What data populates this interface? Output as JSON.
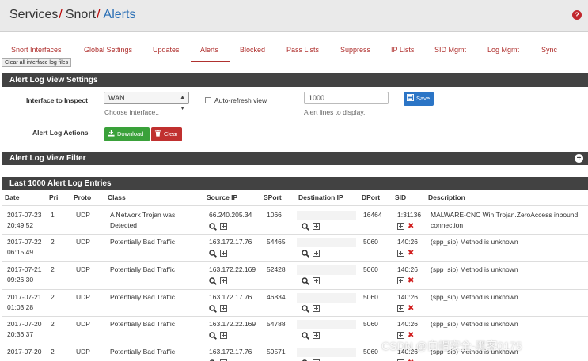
{
  "breadcrumb": {
    "part1": "Services",
    "part2": "Snort",
    "part3": "Alerts",
    "separator": "/"
  },
  "help_icon_glyph": "?",
  "tabs": [
    {
      "label": "Snort Interfaces"
    },
    {
      "label": "Global Settings"
    },
    {
      "label": "Updates"
    },
    {
      "label": "Alerts"
    },
    {
      "label": "Blocked"
    },
    {
      "label": "Pass Lists"
    },
    {
      "label": "Suppress"
    },
    {
      "label": "IP Lists"
    },
    {
      "label": "SID Mgmt"
    },
    {
      "label": "Log Mgmt"
    },
    {
      "label": "Sync"
    }
  ],
  "tooltip": "Clear all interface log files",
  "settings": {
    "title": "Alert Log View Settings",
    "interface_label": "Interface to Inspect",
    "interface_value": "WAN",
    "interface_help": "Choose interface..",
    "autorefresh_label": "Auto-refresh view",
    "lines_value": "1000",
    "lines_help": "Alert lines to display.",
    "save_label": "Save",
    "actions_label": "Alert Log Actions",
    "download_label": "Download",
    "clear_label": "Clear"
  },
  "filter": {
    "title": "Alert Log View Filter"
  },
  "entries": {
    "title": "Last 1000 Alert Log Entries",
    "columns": [
      "Date",
      "Pri",
      "Proto",
      "Class",
      "Source IP",
      "SPort",
      "Destination IP",
      "DPort",
      "SID",
      "Description"
    ],
    "rows": [
      {
        "date1": "2017-07-23",
        "date2": "20:49:52",
        "pri": "1",
        "proto": "UDP",
        "class1": "A Network Trojan was",
        "class2": "Detected",
        "src": "66.240.205.34",
        "sport": "1066",
        "dport": "16464",
        "sid": "1:31136",
        "desc1": "MALWARE-CNC Win.Trojan.ZeroAccess inbound",
        "desc2": "connection"
      },
      {
        "date1": "2017-07-22",
        "date2": "06:15:49",
        "pri": "2",
        "proto": "UDP",
        "class1": "Potentially Bad Traffic",
        "class2": "",
        "src": "163.172.17.76",
        "sport": "54465",
        "dport": "5060",
        "sid": "140:26",
        "desc1": "(spp_sip) Method is unknown",
        "desc2": ""
      },
      {
        "date1": "2017-07-21",
        "date2": "09:26:30",
        "pri": "2",
        "proto": "UDP",
        "class1": "Potentially Bad Traffic",
        "class2": "",
        "src": "163.172.22.169",
        "sport": "52428",
        "dport": "5060",
        "sid": "140:26",
        "desc1": "(spp_sip) Method is unknown",
        "desc2": ""
      },
      {
        "date1": "2017-07-21",
        "date2": "01:03:28",
        "pri": "2",
        "proto": "UDP",
        "class1": "Potentially Bad Traffic",
        "class2": "",
        "src": "163.172.17.76",
        "sport": "46834",
        "dport": "5060",
        "sid": "140:26",
        "desc1": "(spp_sip) Method is unknown",
        "desc2": ""
      },
      {
        "date1": "2017-07-20",
        "date2": "20:36:37",
        "pri": "2",
        "proto": "UDP",
        "class1": "Potentially Bad Traffic",
        "class2": "",
        "src": "163.172.22.169",
        "sport": "54788",
        "dport": "5060",
        "sid": "140:26",
        "desc1": "(spp_sip) Method is unknown",
        "desc2": ""
      },
      {
        "date1": "2017-07-20",
        "date2": "",
        "pri": "2",
        "proto": "UDP",
        "class1": "Potentially Bad Traffic",
        "class2": "",
        "src": "163.172.17.76",
        "sport": "59571",
        "dport": "5060",
        "sid": "140:26",
        "desc1": "(spp_sip) Method is unknown",
        "desc2": ""
      }
    ]
  },
  "watermark": "CSDN @白帽安全-黑客0175",
  "colors": {
    "accent": "#2a6fb5",
    "tab_red": "#b0312f",
    "panel_dark": "#424242",
    "save_blue": "#2b75c6",
    "download_green": "#3aa13a",
    "clear_red": "#c0302f"
  }
}
